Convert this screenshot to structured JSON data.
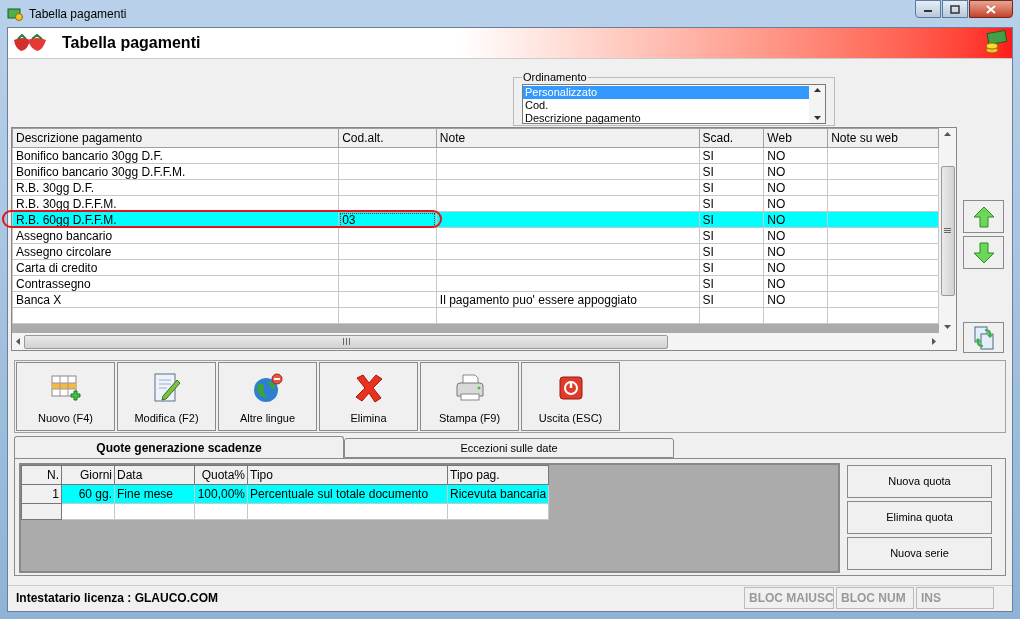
{
  "window": {
    "title": "Tabella pagamenti"
  },
  "header": {
    "title": "Tabella pagamenti"
  },
  "ordinamento": {
    "label": "Ordinamento",
    "items": [
      {
        "label": "Personalizzato",
        "selected": true
      },
      {
        "label": "Cod.",
        "selected": false
      },
      {
        "label": "Descrizione pagamento",
        "selected": false
      }
    ]
  },
  "table": {
    "columns": [
      "Descrizione pagamento",
      "Cod.alt.",
      "Note",
      "Scad.",
      "Web",
      "Note su web"
    ],
    "rows": [
      {
        "descrizione": "Bonifico bancario 30gg D.F.",
        "scad": "SI",
        "web": "NO",
        "selected": false,
        "cod_alt_focused": false
      },
      {
        "descrizione": "Bonifico bancario 30gg D.F.F.M.",
        "scad": "SI",
        "web": "NO",
        "selected": false,
        "cod_alt_focused": false
      },
      {
        "descrizione": "R.B. 30gg D.F.",
        "scad": "SI",
        "web": "NO",
        "selected": false,
        "cod_alt_focused": false
      },
      {
        "descrizione": "R.B. 30gg D.F.F.M.",
        "scad": "SI",
        "web": "NO",
        "selected": false,
        "cod_alt_focused": false
      },
      {
        "descrizione": "R.B. 60gg D.F.F.M.",
        "cod_alt": "03",
        "scad": "SI",
        "web": "NO",
        "selected": true,
        "cod_alt_focused": true
      },
      {
        "descrizione": "Assegno bancario",
        "scad": "SI",
        "web": "NO",
        "selected": false,
        "cod_alt_focused": false
      },
      {
        "descrizione": "Assegno circolare",
        "scad": "SI",
        "web": "NO",
        "selected": false,
        "cod_alt_focused": false
      },
      {
        "descrizione": "Carta di credito",
        "scad": "SI",
        "web": "NO",
        "selected": false,
        "cod_alt_focused": false
      },
      {
        "descrizione": "Contrassegno",
        "scad": "SI",
        "web": "NO",
        "selected": false,
        "cod_alt_focused": false
      },
      {
        "descrizione": "Banca X",
        "note": "Il pagamento puo' essere appoggiato",
        "scad": "SI",
        "web": "NO",
        "selected": false,
        "cod_alt_focused": false
      }
    ]
  },
  "toolbar": [
    {
      "kind": "new",
      "label": "Nuovo (F4)"
    },
    {
      "kind": "edit",
      "label": "Modifica (F2)"
    },
    {
      "kind": "languages",
      "label": "Altre lingue"
    },
    {
      "kind": "delete",
      "label": "Elimina"
    },
    {
      "kind": "print",
      "label": "Stampa (F9)"
    },
    {
      "kind": "exit",
      "label": "Uscita (ESC)"
    }
  ],
  "tabs": [
    {
      "label": "Quote generazione scadenze",
      "selected": true
    },
    {
      "label": "Eccezioni sulle date",
      "selected": false
    }
  ],
  "quote_table": {
    "columns": [
      "N.",
      "Giorni",
      "Data",
      "Quota%",
      "Tipo",
      "Tipo pag."
    ],
    "rows": [
      {
        "n": "1",
        "giorni": "60 gg.",
        "data": "Fine mese",
        "quota": "100,00%",
        "tipo": "Percentuale sul totale documento",
        "tipo_pag": "Ricevuta bancaria",
        "selected": true
      }
    ]
  },
  "quote_buttons": [
    "Nuova quota",
    "Elimina quota",
    "Nuova serie"
  ],
  "status_bar": {
    "license": "Intestatario licenza : GLAUCO.COM",
    "indicators": [
      {
        "label": "BLOC MAIUSC",
        "on": false
      },
      {
        "label": "BLOC NUM",
        "on": false
      },
      {
        "label": "INS",
        "on": false
      }
    ]
  }
}
